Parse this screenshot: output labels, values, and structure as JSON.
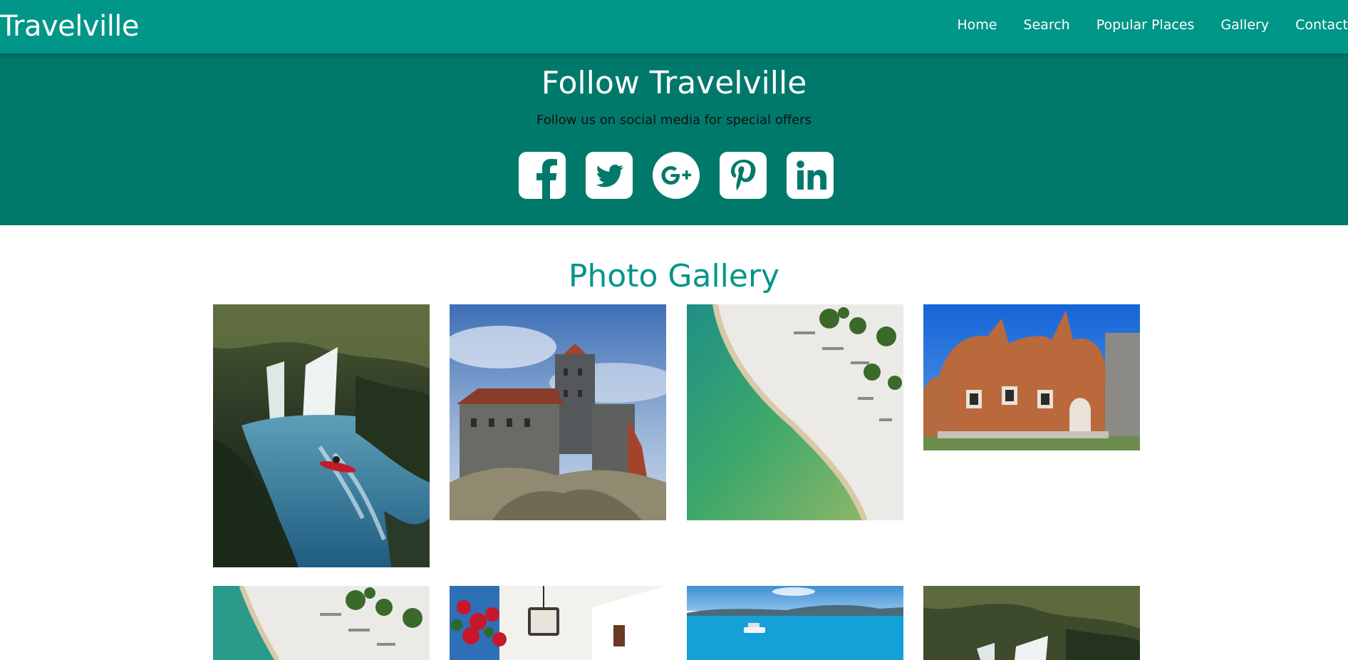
{
  "header": {
    "brand": "Travelville",
    "nav": [
      "Home",
      "Search",
      "Popular Places",
      "Gallery",
      "Contact"
    ]
  },
  "follow": {
    "title": "Follow Travelville",
    "subtitle": "Follow us on social media for special offers",
    "icons": [
      "facebook-icon",
      "twitter-icon",
      "google-plus-icon",
      "pinterest-icon",
      "linkedin-icon"
    ]
  },
  "gallery": {
    "title": "Photo Gallery",
    "photos": [
      "waterfall-kayak",
      "castle",
      "beach-aerial",
      "clay-castle",
      "beach-aerial",
      "flower-street",
      "sea-boat",
      "waterfall"
    ]
  },
  "colors": {
    "nav_bg": "#009688",
    "follow_bg": "#00796b",
    "accent": "#009688"
  }
}
